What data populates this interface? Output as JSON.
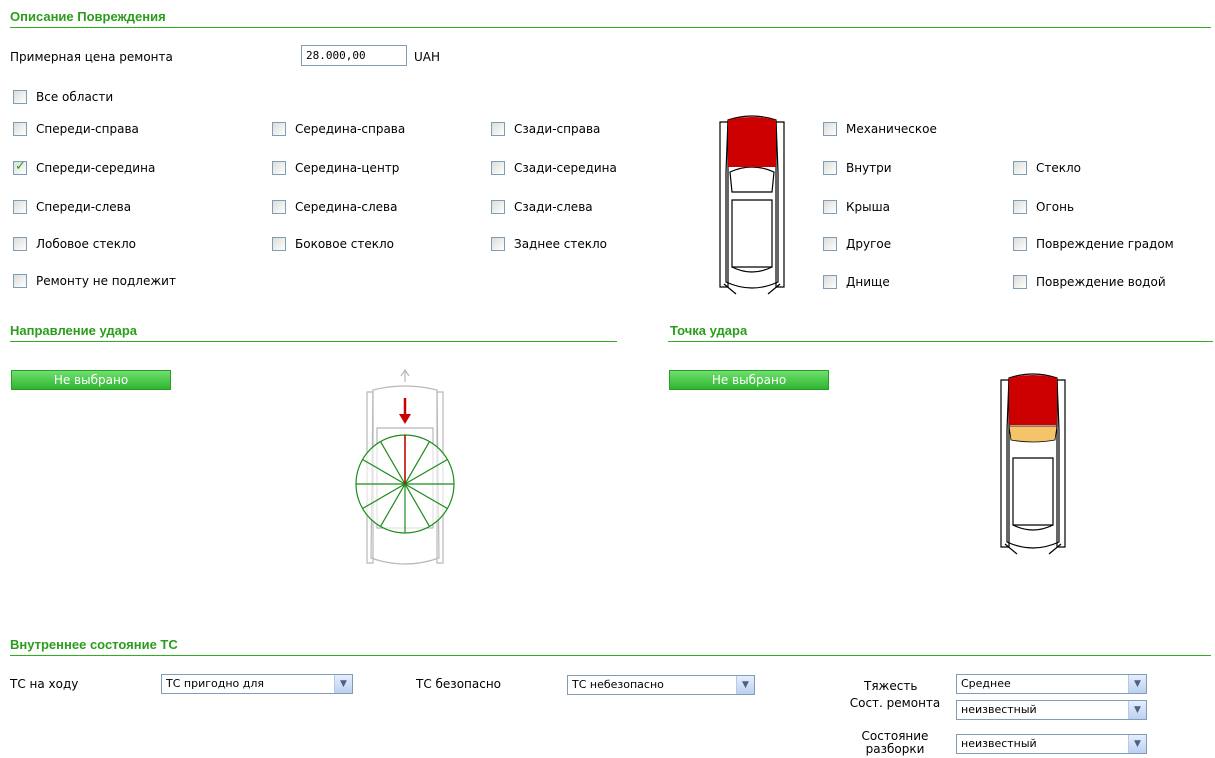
{
  "damage": {
    "title": "Описание Повреждения",
    "price_label": "Примерная цена ремонта",
    "price_value": "28.000,00",
    "currency": "UAH",
    "all_areas": "Все области",
    "areas": [
      {
        "label": "Спереди-справа",
        "checked": false
      },
      {
        "label": "Середина-справа",
        "checked": false
      },
      {
        "label": "Сзади-справа",
        "checked": false
      },
      {
        "label": "Спереди-середина",
        "checked": true
      },
      {
        "label": "Середина-центр",
        "checked": false
      },
      {
        "label": "Сзади-середина",
        "checked": false
      },
      {
        "label": "Спереди-слева",
        "checked": false
      },
      {
        "label": "Середина-слева",
        "checked": false
      },
      {
        "label": "Сзади-слева",
        "checked": false
      },
      {
        "label": "Лобовое стекло",
        "checked": false
      },
      {
        "label": "Боковое стекло",
        "checked": false
      },
      {
        "label": "Заднее стекло",
        "checked": false
      }
    ],
    "not_repairable": "Ремонту не подлежит",
    "types": [
      {
        "label": "Механическое"
      },
      {
        "label": "Внутри"
      },
      {
        "label": "Стекло"
      },
      {
        "label": "Крыша"
      },
      {
        "label": "Огонь"
      },
      {
        "label": "Другое"
      },
      {
        "label": "Повреждение градом"
      },
      {
        "label": "Днище"
      },
      {
        "label": "Повреждение водой"
      }
    ]
  },
  "impact_direction": {
    "title": "Направление удара",
    "button": "Не выбрано"
  },
  "impact_point": {
    "title": "Точка удара",
    "button": "Не выбрано"
  },
  "internal": {
    "title": "Внутреннее состояние ТС",
    "drivable_label": "ТС на ходу",
    "drivable_value": "ТС пригодно для передвижения",
    "safe_label": "ТС безопасно",
    "safe_value": "ТС небезопасно",
    "severity_label": "Тяжесть",
    "severity_value": "Среднее",
    "repair_state_label": "Сост. ремонта",
    "repair_state_value": "неизвестный",
    "disassembly_label": "Состояние разборки",
    "disassembly_value": "неизвестный"
  },
  "colors": {
    "accent": "#2fae1f",
    "damage_red": "#cc0000",
    "impact_orange": "#f5c46a",
    "button_green": "#3cc43c"
  }
}
